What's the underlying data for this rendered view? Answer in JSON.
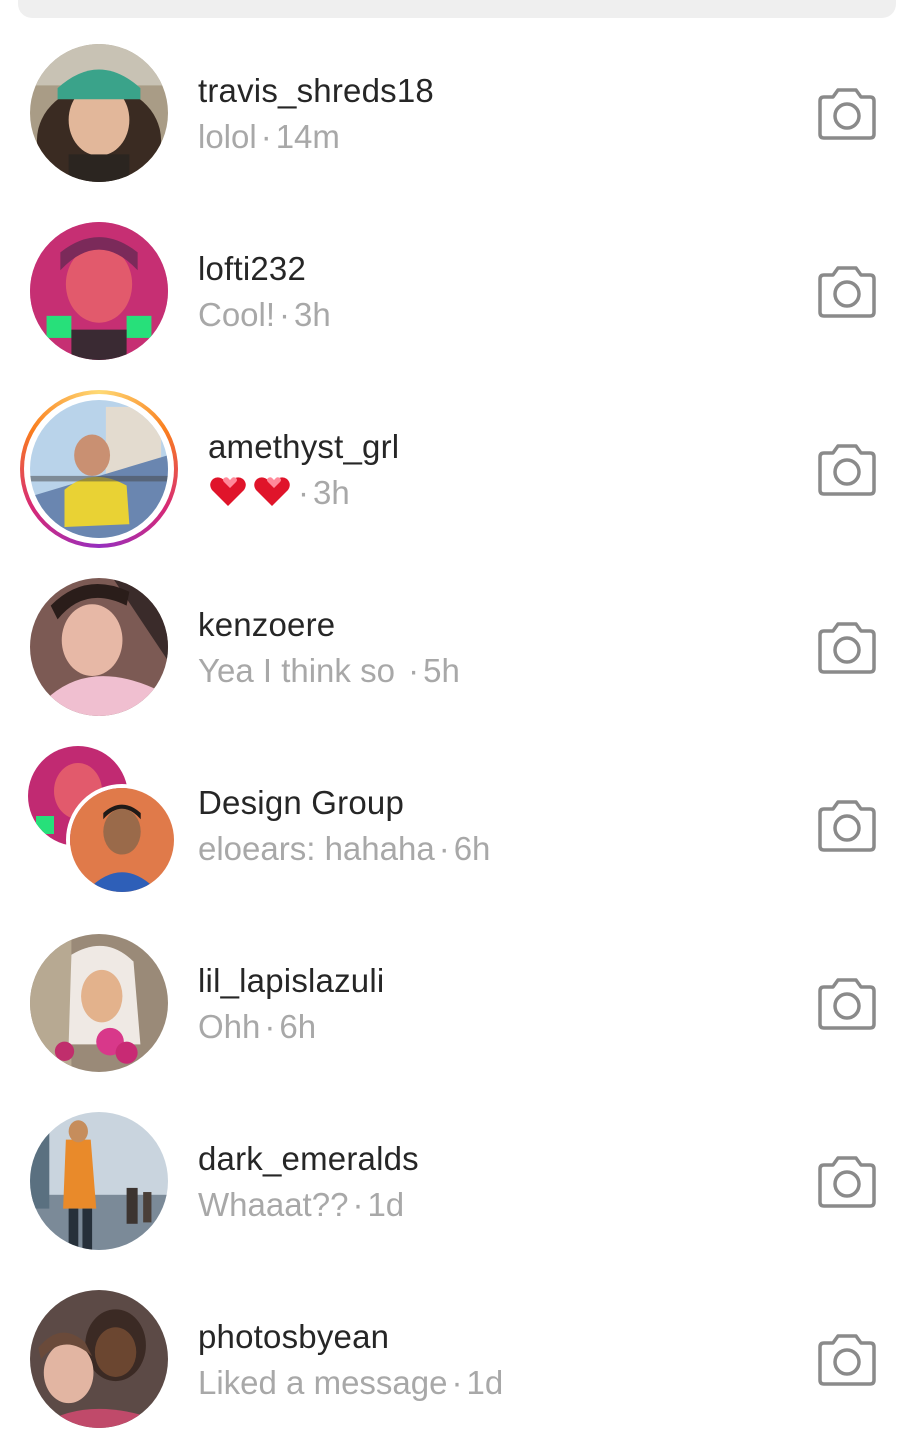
{
  "threads": [
    {
      "username": "travis_shreds18",
      "preview": "lolol",
      "time": "14m"
    },
    {
      "username": "lofti232",
      "preview": "Cool!",
      "time": "3h"
    },
    {
      "username": "amethyst_grl",
      "preview": "",
      "time": "3h",
      "preview_icon": "two-hearts-emoji-icon"
    },
    {
      "username": "kenzoere",
      "preview": "Yea I think so ",
      "time": "5h"
    },
    {
      "username": "Design Group",
      "preview": "eloears: hahaha",
      "time": "6h"
    },
    {
      "username": "lil_lapislazuli",
      "preview": "Ohh",
      "time": "6h"
    },
    {
      "username": "dark_emeralds",
      "preview": "Whaaat??",
      "time": "1d"
    },
    {
      "username": "photosbyean",
      "preview": "Liked a message",
      "time": "1d"
    }
  ],
  "separator": "·",
  "icons": {
    "row_action": "camera-icon"
  },
  "colors": {
    "primary_text": "#262626",
    "secondary_text": "#a8a8a8",
    "icon": "#262626"
  }
}
